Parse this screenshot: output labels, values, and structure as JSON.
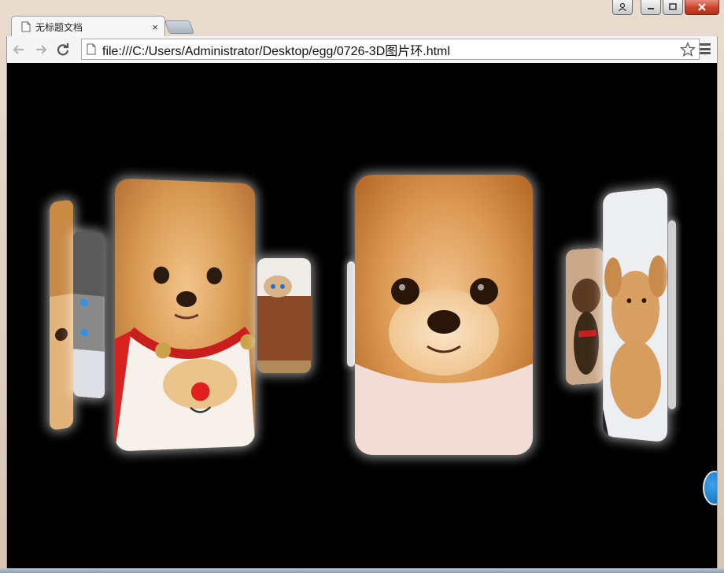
{
  "window": {
    "controls": [
      "user",
      "minimize",
      "maximize",
      "close"
    ]
  },
  "tab": {
    "title": "无标题文档",
    "close_glyph": "×"
  },
  "toolbar": {
    "back_icon": "back-arrow-icon",
    "forward_icon": "forward-arrow-icon",
    "reload_icon": "reload-icon",
    "url": "file:///C:/Users/Administrator/Desktop/egg/0726-3D图片环.html",
    "bookmark_icon": "star-icon",
    "menu_icon": "hamburger-menu-icon"
  },
  "carousel": {
    "cards": [
      {
        "subject": "pomeranian",
        "role": "far-left"
      },
      {
        "subject": "kitten",
        "role": "left-back"
      },
      {
        "subject": "pomeranian-bib",
        "role": "left"
      },
      {
        "subject": "kitten-in-box",
        "role": "center-left-back"
      },
      {
        "subject": "pomeranian-face",
        "role": "center"
      },
      {
        "subject": "yorkie",
        "role": "right-back"
      },
      {
        "subject": "bunny",
        "role": "right"
      }
    ]
  },
  "colors": {
    "viewport_bg": "#000000",
    "close_button": "#c8432a",
    "frame": "#d7c5b3"
  }
}
